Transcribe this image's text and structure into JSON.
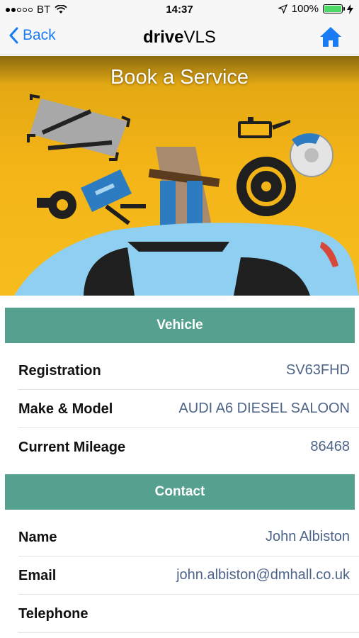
{
  "status_bar": {
    "carrier": "BT",
    "time": "14:37",
    "battery": "100%",
    "battery_level": 1.0
  },
  "nav": {
    "back_label": "Back",
    "title_bold": "drive",
    "title_regular": "VLS",
    "home_icon": "home-icon"
  },
  "banner": {
    "title": "Book a Service"
  },
  "vehicle": {
    "header": "Vehicle",
    "rows": [
      {
        "label": "Registration",
        "value": "SV63FHD"
      },
      {
        "label": "Make & Model",
        "value": "AUDI A6 DIESEL SALOON"
      },
      {
        "label": "Current Mileage",
        "value": "86468"
      }
    ]
  },
  "contact": {
    "header": "Contact",
    "rows": [
      {
        "label": "Name",
        "value": "John Albiston"
      },
      {
        "label": "Email",
        "value": "john.albiston@dmhall.co.uk"
      },
      {
        "label": "Telephone",
        "value": ""
      }
    ]
  },
  "colors": {
    "accent": "#1a7cf5",
    "section_header": "#55a08f",
    "banner": "#f3b417",
    "value_text": "#4e6488"
  }
}
